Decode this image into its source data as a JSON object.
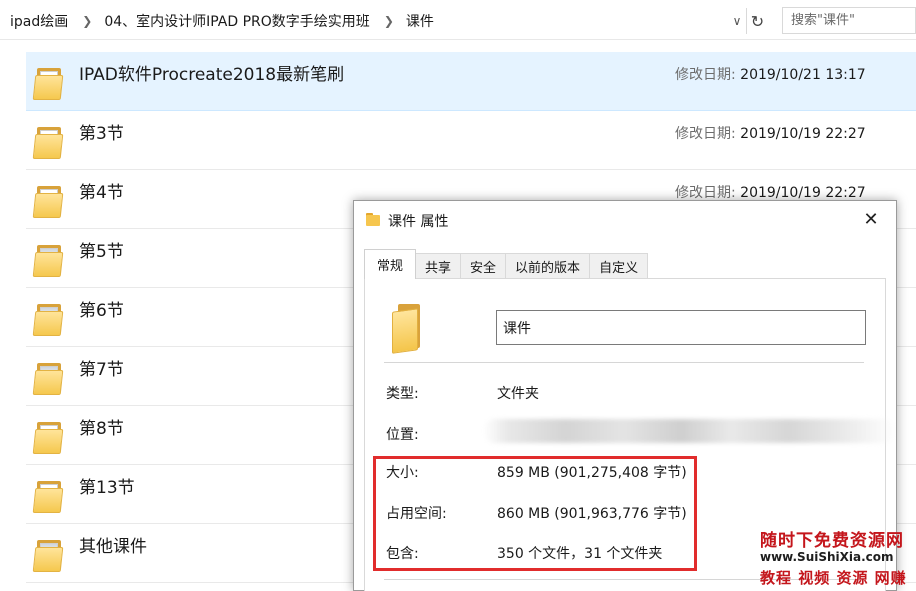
{
  "address_bar": {
    "breadcrumbs": [
      "ipad绘画",
      "04、室内设计师IPAD PRO数字手绘实用班",
      "课件"
    ],
    "search_placeholder": "搜索\"课件\""
  },
  "file_list": {
    "date_label": "修改日期:",
    "items": [
      {
        "name": "IPAD软件Procreate2018最新笔刷",
        "modified": "2019/10/21 13:17",
        "selected": true
      },
      {
        "name": "第3节",
        "modified": "2019/10/19 22:27"
      },
      {
        "name": "第4节",
        "modified": "2019/10/19 22:27"
      },
      {
        "name": "第5节"
      },
      {
        "name": "第6节"
      },
      {
        "name": "第7节"
      },
      {
        "name": "第8节"
      },
      {
        "name": "第13节"
      },
      {
        "name": "其他课件"
      }
    ]
  },
  "dialog": {
    "title": "课件 属性",
    "tabs": [
      "常规",
      "共享",
      "安全",
      "以前的版本",
      "自定义"
    ],
    "active_tab": "常规",
    "folder_name": "课件",
    "properties": [
      {
        "label": "类型:",
        "value": "文件夹"
      },
      {
        "label": "位置:",
        "value": ""
      },
      {
        "label": "大小:",
        "value": "859 MB (901,275,408 字节)"
      },
      {
        "label": "占用空间:",
        "value": "860 MB (901,963,776 字节)"
      },
      {
        "label": "包含:",
        "value": "350 个文件，31 个文件夹"
      }
    ],
    "highlight_color": "#e12c2c"
  },
  "watermark": {
    "line1": "随时下免费资源网",
    "line2": "www.SuiShiXia.com",
    "line3": "教程 视频 资源 网赚",
    "color": "#c4161c"
  },
  "colors": {
    "selected_row": "#e5f3ff",
    "folder_yellow": "#f5c84e"
  }
}
